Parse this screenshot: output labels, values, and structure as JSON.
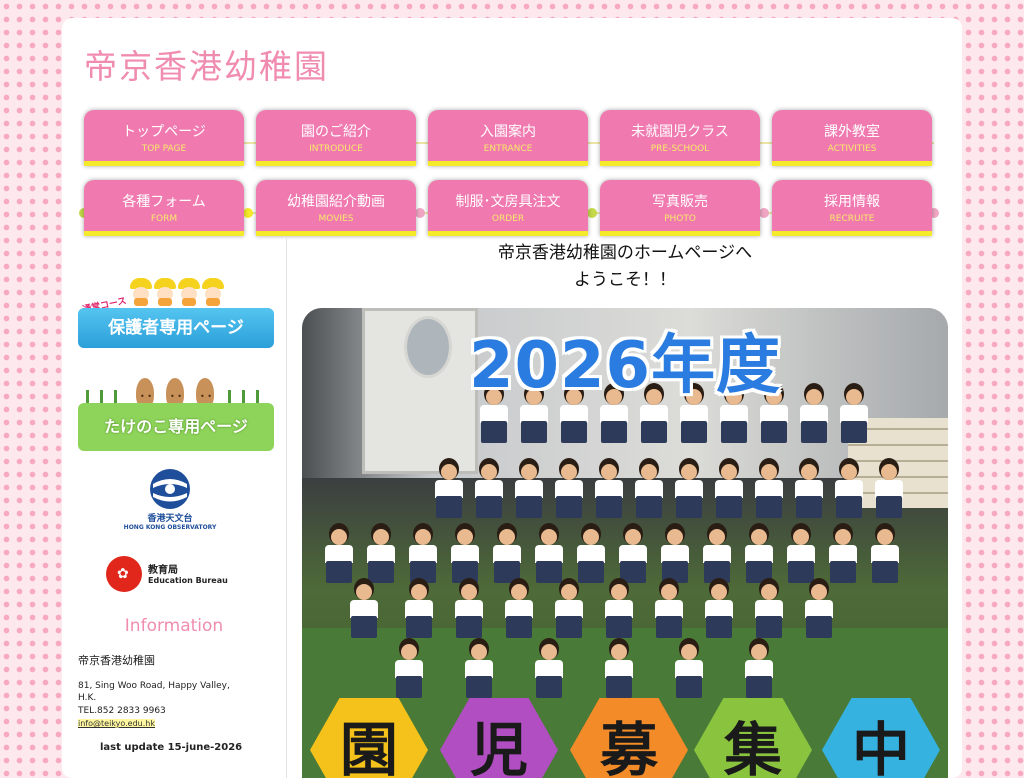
{
  "site": {
    "title": "帝京香港幼稚園"
  },
  "nav": [
    {
      "jp": "トップページ",
      "en": "TOP PAGE"
    },
    {
      "jp": "園のご紹介",
      "en": "INTRODUCE"
    },
    {
      "jp": "入園案内",
      "en": "ENTRANCE"
    },
    {
      "jp": "未就園児クラス",
      "en": "PRE-SCHOOL"
    },
    {
      "jp": "課外教室",
      "en": "ACTIVITIES"
    },
    {
      "jp": "各種フォーム",
      "en": "FORM"
    },
    {
      "jp": "幼稚園紹介動画",
      "en": "MOVIES"
    },
    {
      "jp": "制服･文房具注文",
      "en": "ORDER"
    },
    {
      "jp": "写真販売",
      "en": "PHOTO"
    },
    {
      "jp": "採用情報",
      "en": "RECRUITE"
    }
  ],
  "sidebar": {
    "banner_parent": {
      "tag": "通常コース",
      "label": "保護者専用ページ"
    },
    "banner_bamboo": {
      "label": "たけのこ専用ページ"
    },
    "hko": {
      "cn": "香港天文台",
      "en": "HONG KONG OBSERVATORY"
    },
    "edb": {
      "cn": "教育局",
      "en": "Education Bureau"
    },
    "info": {
      "title": "Information",
      "name": "帝京香港幼稚園",
      "address": "81, Sing Woo Road, Happy Valley, H.K.",
      "tel": "TEL.852 2833 9963",
      "email": "info@teikyo.edu.hk"
    },
    "last_update": "last update 15-june-2026"
  },
  "main": {
    "welcome_line1": "帝京香港幼稚園のホームページへ",
    "welcome_line2": "ようこそ！！",
    "hero": {
      "year_text": "2026年度",
      "hex_chars": [
        "園",
        "児",
        "募",
        "集",
        "中"
      ],
      "hex_colors": [
        "#f4c21b",
        "#b14fc2",
        "#f28b28",
        "#8ac43f",
        "#36b2e0"
      ]
    }
  },
  "colors": {
    "brand_pink": "#f08cb0",
    "nav_pink": "#f07ab0",
    "nav_accent_yellow": "#f5ea2a",
    "year_blue": "#2b7ce0"
  }
}
